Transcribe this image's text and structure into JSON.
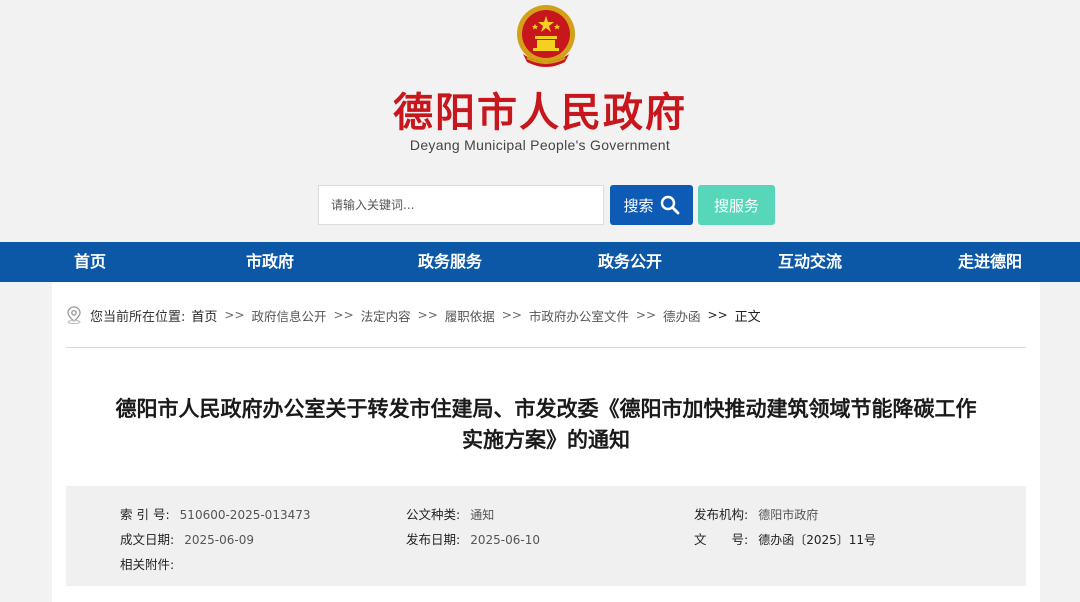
{
  "header": {
    "site_title": "德阳市人民政府",
    "site_subtitle": "Deyang Municipal People's Government",
    "emblem_icon": "national-emblem-icon",
    "search_placeholder": "请输入关键词...",
    "search_button": "搜索",
    "service_button": "搜服务"
  },
  "colors": {
    "brand_red": "#c8161d",
    "nav_blue": "#0c57a6",
    "search_blue": "#0e5bb5",
    "service_green": "#57d6b9"
  },
  "nav": {
    "items": [
      "首页",
      "市政府",
      "政务服务",
      "政务公开",
      "互动交流",
      "走进德阳"
    ]
  },
  "breadcrumb": {
    "prefix": "您当前所在位置:",
    "home": "首页",
    "items": [
      "政府信息公开",
      "法定内容",
      "履职依据",
      "市政府办公室文件",
      "德办函"
    ],
    "current": "正文",
    "separator": ">>"
  },
  "document": {
    "title_line1": "德阳市人民政府办公室关于转发市住建局、市发改委《德阳市加快推动建筑领域节能降碳工作",
    "title_line2": "实施方案》的通知",
    "meta": {
      "index_label": "索 引 号:",
      "index_value": "510600-2025-013473",
      "type_label": "公文种类:",
      "type_value": "通知",
      "publisher_label": "发布机构:",
      "publisher_value": "德阳市政府",
      "created_label": "成文日期:",
      "created_value": "2025-06-09",
      "published_label": "发布日期:",
      "published_value": "2025-06-10",
      "docno_label": "文　　号:",
      "docno_value": "德办函〔2025〕11号",
      "attachments_label": "相关附件:"
    }
  }
}
